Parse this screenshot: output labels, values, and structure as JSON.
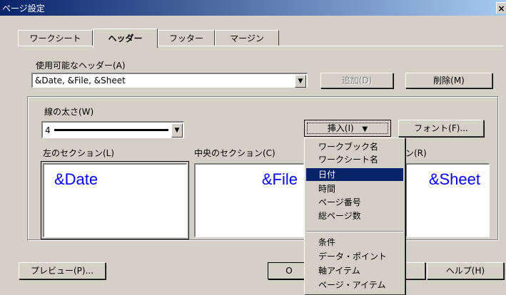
{
  "window": {
    "title": "ページ設定",
    "close_label": "×"
  },
  "tabs": [
    {
      "label": "ワークシート",
      "active": false
    },
    {
      "label": "ヘッダー",
      "active": true
    },
    {
      "label": "フッター",
      "active": false
    },
    {
      "label": "マージン",
      "active": false
    }
  ],
  "available_headers": {
    "label": "使用可能なヘッダー(A)",
    "value": "&Date, &File, &Sheet"
  },
  "buttons": {
    "add": "追加(D)",
    "delete": "削除(M)",
    "insert": "挿入(I)",
    "font": "フォント(F)...",
    "preview": "プレビュー(P)...",
    "help": "ヘルプ(H)",
    "ok_partial": "O"
  },
  "line_width": {
    "label": "線の太さ(W)",
    "value": "4"
  },
  "sections": {
    "left": {
      "label": "左のセクション(L)",
      "text": "&Date"
    },
    "center": {
      "label": "中央のセクション(C)",
      "text": "&File"
    },
    "right": {
      "label_partial": "ン(R)",
      "text": "&Sheet"
    }
  },
  "insert_menu": {
    "items_group1": [
      "ワークブック名",
      "ワークシート名",
      "日付",
      "時間",
      "ページ番号",
      "総ページ数"
    ],
    "items_group2": [
      "条件",
      "データ・ポイント",
      "軸アイテム",
      "ページ・アイテム"
    ],
    "highlighted": "日付"
  },
  "colors": {
    "accent": "#0a246a",
    "section_text": "#0000ff",
    "face": "#d4d0c8"
  }
}
